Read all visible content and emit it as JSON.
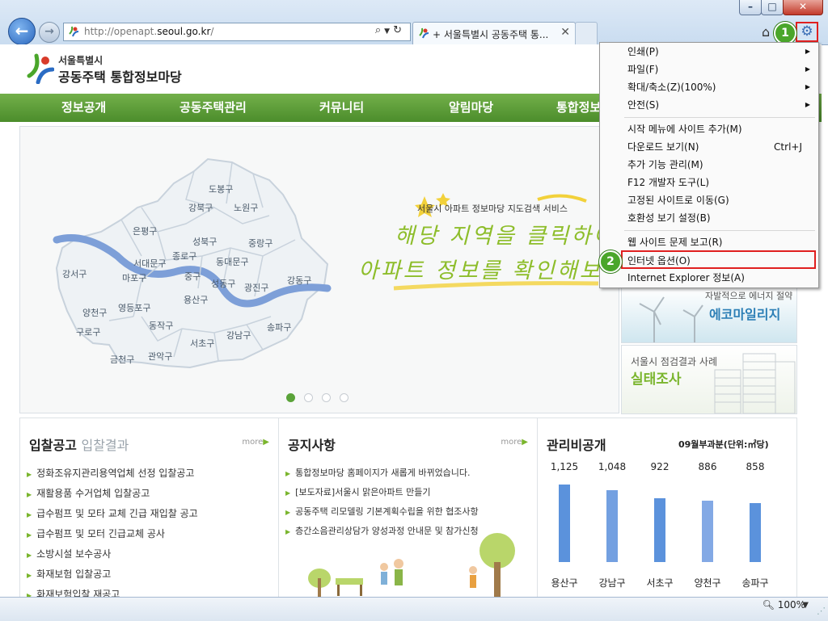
{
  "browser": {
    "address_url_prefix": "http://openapt.",
    "address_url_domain": "seoul.go.kr",
    "address_url_suffix": "/",
    "tab_title": "+ 서울특별시 공동주택 통...",
    "zoom": "100%",
    "window_controls": [
      "minimize-icon",
      "maximize-icon",
      "close-icon"
    ]
  },
  "site": {
    "logo_city": "서울특별시",
    "logo_name": "공동주택 통합정보마당",
    "gnb": [
      "정보공개",
      "공동주택관리",
      "커뮤니티",
      "알림마당",
      "통합정보"
    ]
  },
  "banner": {
    "service_text": "서울시 아파트 정보마당 지도검색 서비스",
    "slogan_line1": "해당 지역을 클릭하여",
    "slogan_line2": "아파트 정보를 확인해보세요",
    "districts": [
      "도봉구",
      "강북구",
      "노원구",
      "은평구",
      "성북구",
      "중랑구",
      "서대문구",
      "종로구",
      "동대문구",
      "강서구",
      "마포구",
      "중구",
      "성동구",
      "광진구",
      "강동구",
      "양천구",
      "영등포구",
      "용산구",
      "구로구",
      "동작구",
      "서초구",
      "강남구",
      "송파구",
      "금천구",
      "관악구"
    ],
    "slides": 4,
    "active_slide": 1
  },
  "side": {
    "eco_sub": "자발적으로 에너지 절약",
    "eco_title": "에코마일리지",
    "inspect_sub": "서울시 점검결과 사례",
    "inspect_title": "실태조사"
  },
  "boards": {
    "bid": {
      "title": "입찰공고",
      "subtitle": "입찰결과",
      "more": "more",
      "items": [
        "정화조유지관리용역업체 선정 입찰공고",
        "재활용품 수거업체 입찰공고",
        "급수펌프 및 모타 교체 긴급 재입찰 공고",
        "급수펌프 및 모터 긴급교체 공사",
        "소방시설 보수공사",
        "화재보험 입찰공고",
        "화재보험입찰 재공고"
      ]
    },
    "notice": {
      "title": "공지사항",
      "more": "more",
      "items": [
        "통합정보마당 홈페이지가 새롭게 바뀌었습니다.",
        "[보도자료]서울시 맑은아파트 만들기",
        "공동주택 리모델링 기본계획수립을 위한 협조사항",
        "층간소음관리상담가 양성과정 안내문 및 참가신청"
      ]
    },
    "fee": {
      "title": "관리비공개",
      "period": "09월부과분(단위:㎡당)"
    }
  },
  "chart_data": {
    "type": "bar",
    "categories": [
      "용산구",
      "강남구",
      "서초구",
      "양천구",
      "송파구"
    ],
    "values": [
      1125,
      1048,
      922,
      886,
      858
    ],
    "value_labels": [
      "1,125",
      "1,048",
      "922",
      "886",
      "858"
    ],
    "title": "관리비공개",
    "subtitle": "09월부과분(단위:㎡당)",
    "colors": [
      "#3e7fd6",
      "#5b8fdc",
      "#3e7fd6",
      "#6d9ae0",
      "#3e7fd6"
    ]
  },
  "menu": {
    "items": [
      {
        "label": "인쇄(P)",
        "submenu": true
      },
      {
        "label": "파일(F)",
        "submenu": true
      },
      {
        "label": "확대/축소(Z)(100%)",
        "submenu": true
      },
      {
        "label": "안전(S)",
        "submenu": true
      },
      {
        "label": "시작 메뉴에 사이트 추가(M)"
      },
      {
        "label": "다운로드 보기(N)",
        "shortcut": "Ctrl+J"
      },
      {
        "label": "추가 기능 관리(M)"
      },
      {
        "label": "F12 개발자 도구(L)"
      },
      {
        "label": "고정된 사이트로 이동(G)"
      },
      {
        "label": "호환성 보기 설정(B)"
      },
      {
        "label": "웹 사이트 문제 보고(R)"
      },
      {
        "label": "인터넷 옵션(O)"
      },
      {
        "label": "Internet Explorer 정보(A)"
      }
    ]
  },
  "annotations": {
    "step1": "1",
    "step2": "2"
  },
  "colors": {
    "accent_green": "#5aa339",
    "highlight_red": "#e01f1f",
    "bar_blue": "#3e7fd6"
  }
}
